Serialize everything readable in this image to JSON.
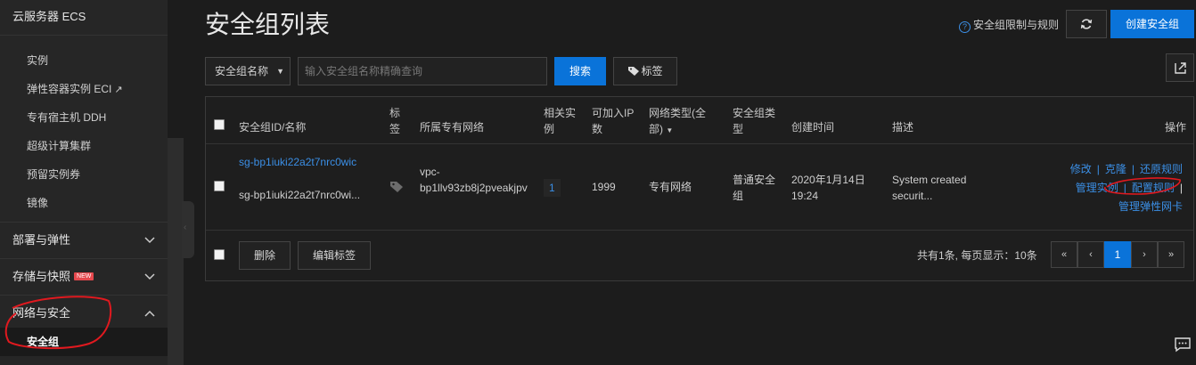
{
  "sidebar": {
    "title": "云服务器 ECS",
    "items": [
      {
        "label": "实例"
      },
      {
        "label": "弹性容器实例 ECI",
        "external": "↗"
      },
      {
        "label": "专有宿主机 DDH"
      },
      {
        "label": "超级计算集群"
      },
      {
        "label": "预留实例券"
      },
      {
        "label": "镜像"
      }
    ],
    "groups": [
      {
        "label": "部署与弹性"
      },
      {
        "label": "存储与快照",
        "badge": "NEW"
      },
      {
        "label": "网络与安全"
      }
    ],
    "active_item": "安全组"
  },
  "header": {
    "title": "安全组列表",
    "help_link": "安全组限制与规则",
    "create_button": "创建安全组",
    "help_icon": "?"
  },
  "filter": {
    "select_value": "安全组名称",
    "search_placeholder": "输入安全组名称精确查询",
    "search_button": "搜索",
    "tags_button": "标签"
  },
  "table": {
    "columns": {
      "id_name": "安全组ID/名称",
      "tags": [
        "标",
        "签"
      ],
      "vpc": "所属专有网络",
      "instances": [
        "相关实",
        "例"
      ],
      "ip": [
        "可加入IP",
        "数"
      ],
      "net_type": [
        "网络类型(全",
        "部)"
      ],
      "sg_type": [
        "安全组类",
        "型"
      ],
      "created": "创建时间",
      "desc": "描述",
      "actions": "操作"
    },
    "rows": [
      {
        "id": "sg-bp1iuki22a2t7nrc0wic",
        "name": "sg-bp1iuki22a2t7nrc0wi...",
        "vpc": [
          "vpc-",
          "bp1llv93zb8j2pveakjpv"
        ],
        "instances": "1",
        "ip_count": "1999",
        "network_type": "专有网络",
        "sg_type": [
          "普通安全",
          "组"
        ],
        "created": [
          "2020年1月14日",
          "19:24"
        ],
        "description": [
          "System created",
          "securit..."
        ],
        "actions": {
          "modify": "修改",
          "clone": "克隆",
          "restore": "还原规则",
          "manage_instances": "管理实例",
          "configure_rules": "配置规则",
          "manage_eni": "管理弹性网卡"
        }
      }
    ]
  },
  "footer": {
    "delete_button": "删除",
    "edit_tags_button": "编辑标签",
    "summary": "共有1条, 每页显示：10条",
    "pager": {
      "first": "«",
      "prev": "‹",
      "current": "1",
      "next": "›",
      "last": "»"
    }
  },
  "colors": {
    "accent": "#0a73d9",
    "link": "#3b8fe6",
    "annotation": "#e0191f"
  }
}
